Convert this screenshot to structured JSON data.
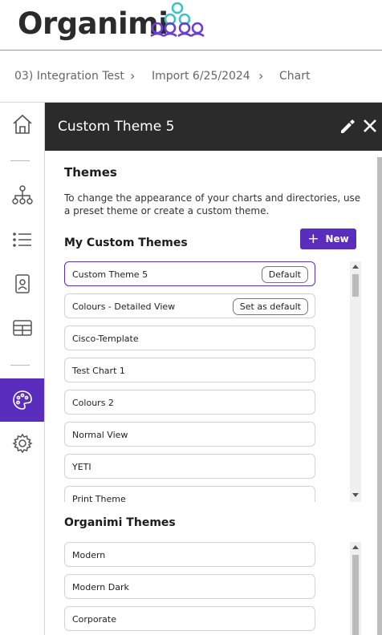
{
  "app": {
    "logo_text": "Organimi"
  },
  "breadcrumb": {
    "items": [
      "03) Integration Test",
      "Import 6/25/2024",
      "Chart"
    ]
  },
  "leftnav": {
    "items": [
      "home-icon",
      "org-chart-icon",
      "list-icon",
      "directory-icon",
      "table-icon",
      "palette-icon",
      "settings-icon"
    ],
    "active": "palette-icon"
  },
  "panel": {
    "title": "Custom Theme 5",
    "heading": "Themes",
    "description": "To change the appearance of your charts and directories, use a preset theme or create a custom theme.",
    "custom_section_title": "My Custom Themes",
    "new_button": {
      "icon": "+",
      "label": "New"
    },
    "custom_themes": [
      {
        "name": "Custom Theme 5",
        "chip": "Default",
        "selected": true
      },
      {
        "name": "Colours - Detailed View",
        "chip": "Set as default",
        "selected": false
      },
      {
        "name": "Cisco-Template",
        "chip": "",
        "selected": false
      },
      {
        "name": "Test Chart 1",
        "chip": "",
        "selected": false
      },
      {
        "name": "Colours 2",
        "chip": "",
        "selected": false
      },
      {
        "name": "Normal View",
        "chip": "",
        "selected": false
      },
      {
        "name": "YETI",
        "chip": "",
        "selected": false
      },
      {
        "name": "Print Theme",
        "chip": "",
        "selected": false
      }
    ],
    "org_section_title": "Organimi Themes",
    "organimi_themes": [
      {
        "name": "Modern"
      },
      {
        "name": "Modern Dark"
      },
      {
        "name": "Corporate"
      }
    ]
  },
  "colors": {
    "accent": "#5a2dbd",
    "header_dark": "#2b2b2b",
    "logo_teal": "#3cc3c3",
    "logo_purple": "#6a3fd0"
  }
}
